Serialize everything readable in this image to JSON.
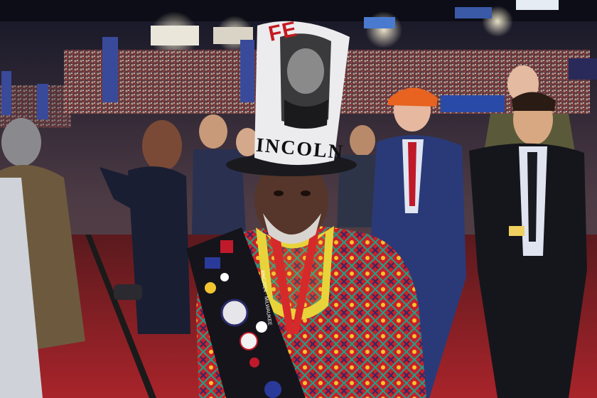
{
  "photo": {
    "hat_text_top": "FE",
    "hat_text_bottom": "INCOLN",
    "lanyard_text": "RNC2024 · MILWAUKEE",
    "colors": {
      "floor": "#9a1e22",
      "hat_band": "#e8e8ea",
      "shirt_main": "#c8202a",
      "shirt_trim": "#1aa38a",
      "orange_cap": "#e8631f",
      "suit_blue": "#2a3a78"
    }
  }
}
